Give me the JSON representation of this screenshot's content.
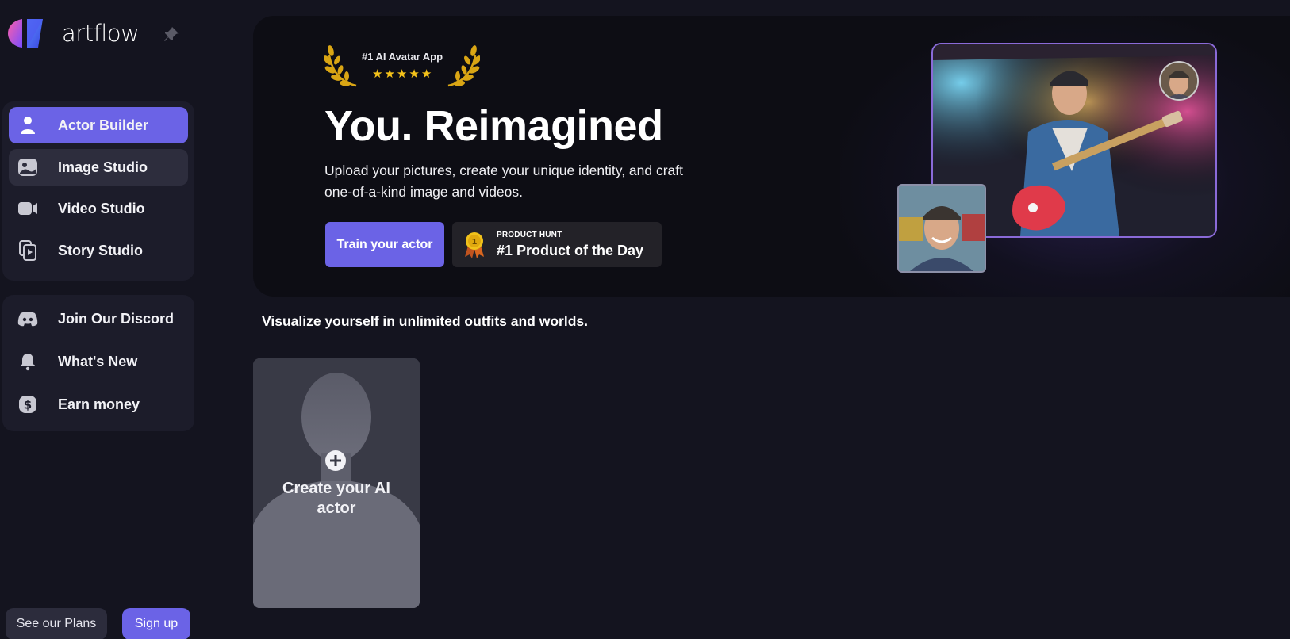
{
  "brand": {
    "name": "artflow"
  },
  "sidebar": {
    "primary": [
      {
        "label": "Actor Builder",
        "icon": "person-icon",
        "state": "active"
      },
      {
        "label": "Image Studio",
        "icon": "image-icon",
        "state": "hover"
      },
      {
        "label": "Video Studio",
        "icon": "video-camera-icon",
        "state": "normal"
      },
      {
        "label": "Story Studio",
        "icon": "story-icon",
        "state": "normal"
      }
    ],
    "secondary": [
      {
        "label": "Join Our Discord",
        "icon": "discord-icon"
      },
      {
        "label": "What's New",
        "icon": "bell-icon"
      },
      {
        "label": "Earn money",
        "icon": "dollar-icon"
      }
    ],
    "plans_label": "See our Plans",
    "signup_label": "Sign up"
  },
  "hero": {
    "award_text": "#1 AI Avatar App",
    "stars": 5,
    "title": "You. Reimagined",
    "subtitle_line1": "Upload your pictures, create your unique identity, and craft",
    "subtitle_line2": " one-of-a-kind image and videos.",
    "train_button": "Train your actor",
    "product_hunt_small": "PRODUCT HUNT",
    "product_hunt_big": "#1 Product of the Day",
    "medal_number": "1"
  },
  "section_title": "Visualize yourself in unlimited outfits and worlds.",
  "create_card": {
    "label_line1": "Create your AI",
    "label_line2": "actor"
  },
  "colors": {
    "accent": "#6b63e6",
    "background": "#14141f",
    "panel": "#1c1c2a",
    "gold": "#f4c21a"
  }
}
